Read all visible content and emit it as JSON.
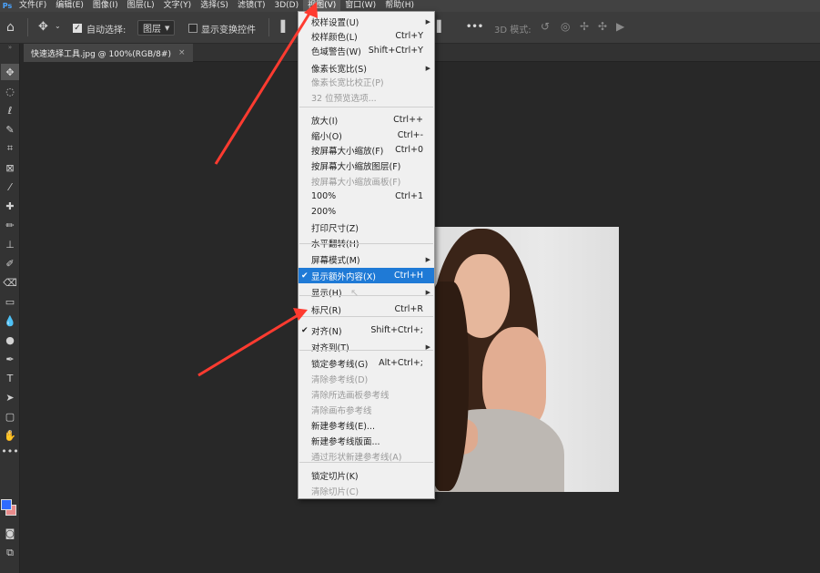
{
  "menubar": {
    "logo": "Ps",
    "items": [
      "文件(F)",
      "编辑(E)",
      "图像(I)",
      "图层(L)",
      "文字(Y)",
      "选择(S)",
      "滤镜(T)",
      "3D(D)",
      "视图(V)",
      "窗口(W)",
      "帮助(H)"
    ],
    "active_index": 8
  },
  "options": {
    "auto_select_label": "自动选择:",
    "auto_select_checked": true,
    "layer_dropdown": "图层",
    "show_transform_label": "显示变换控件",
    "more_label": "•••",
    "mode_3d_label": "3D 模式:"
  },
  "tab": {
    "title": "快速选择工具.jpg @ 100%(RGB/8#)",
    "close": "×"
  },
  "colors": {
    "foreground": "#2f6bff",
    "background": "#e88b8b",
    "highlight": "#1f7ad6",
    "arrow": "#ff3b30"
  },
  "view_menu": {
    "items": [
      {
        "label": "校样设置(U)",
        "shortcut": "",
        "submenu": true,
        "disabled": false
      },
      {
        "label": "校样颜色(L)",
        "shortcut": "Ctrl+Y",
        "disabled": false
      },
      {
        "label": "色域警告(W)",
        "shortcut": "Shift+Ctrl+Y",
        "disabled": false
      },
      {
        "label": "像素长宽比(S)",
        "shortcut": "",
        "submenu": true,
        "disabled": false
      },
      {
        "label": "像素长宽比校正(P)",
        "shortcut": "",
        "disabled": true
      },
      {
        "label": "32 位预览选项...",
        "shortcut": "",
        "disabled": true
      },
      {
        "label": "放大(I)",
        "shortcut": "Ctrl++",
        "disabled": false
      },
      {
        "label": "缩小(O)",
        "shortcut": "Ctrl+-",
        "disabled": false
      },
      {
        "label": "按屏幕大小缩放(F)",
        "shortcut": "Ctrl+0",
        "disabled": false
      },
      {
        "label": "按屏幕大小缩放图层(F)",
        "shortcut": "",
        "disabled": false
      },
      {
        "label": "按屏幕大小缩放画板(F)",
        "shortcut": "",
        "disabled": true
      },
      {
        "label": "100%",
        "shortcut": "Ctrl+1",
        "disabled": false
      },
      {
        "label": "200%",
        "shortcut": "",
        "disabled": false
      },
      {
        "label": "打印尺寸(Z)",
        "shortcut": "",
        "disabled": false
      },
      {
        "label": "水平翻转(H)",
        "shortcut": "",
        "disabled": false
      },
      {
        "label": "屏幕模式(M)",
        "shortcut": "",
        "submenu": true,
        "disabled": false
      },
      {
        "label": "显示额外内容(X)",
        "shortcut": "Ctrl+H",
        "checked": true,
        "highlight": true,
        "disabled": false
      },
      {
        "label": "显示(H)",
        "shortcut": "",
        "submenu": true,
        "disabled": false
      },
      {
        "label": "标尺(R)",
        "shortcut": "Ctrl+R",
        "disabled": false
      },
      {
        "label": "对齐(N)",
        "shortcut": "Shift+Ctrl+;",
        "checked": true,
        "disabled": false
      },
      {
        "label": "对齐到(T)",
        "shortcut": "",
        "submenu": true,
        "disabled": false
      },
      {
        "label": "锁定参考线(G)",
        "shortcut": "Alt+Ctrl+;",
        "disabled": false
      },
      {
        "label": "清除参考线(D)",
        "shortcut": "",
        "disabled": true
      },
      {
        "label": "清除所选画板参考线",
        "shortcut": "",
        "disabled": true
      },
      {
        "label": "清除画布参考线",
        "shortcut": "",
        "disabled": true
      },
      {
        "label": "新建参考线(E)...",
        "shortcut": "",
        "disabled": false
      },
      {
        "label": "新建参考线版面...",
        "shortcut": "",
        "disabled": false
      },
      {
        "label": "通过形状新建参考线(A)",
        "shortcut": "",
        "disabled": true
      },
      {
        "label": "锁定切片(K)",
        "shortcut": "",
        "disabled": false
      },
      {
        "label": "清除切片(C)",
        "shortcut": "",
        "disabled": true
      }
    ]
  },
  "tools": [
    "move-tool-icon",
    "marquee-tool-icon",
    "lasso-tool-icon",
    "quick-selection-tool-icon",
    "crop-tool-icon",
    "frame-tool-icon",
    "eyedropper-tool-icon",
    "healing-brush-icon",
    "brush-tool-icon",
    "clone-stamp-icon",
    "history-brush-icon",
    "eraser-tool-icon",
    "gradient-tool-icon",
    "blur-tool-icon",
    "dodge-tool-icon",
    "pen-tool-icon",
    "type-tool-icon",
    "path-selection-icon",
    "rectangle-tool-icon",
    "hand-tool-icon",
    "zoom-tool-icon",
    "more-tools-icon"
  ]
}
